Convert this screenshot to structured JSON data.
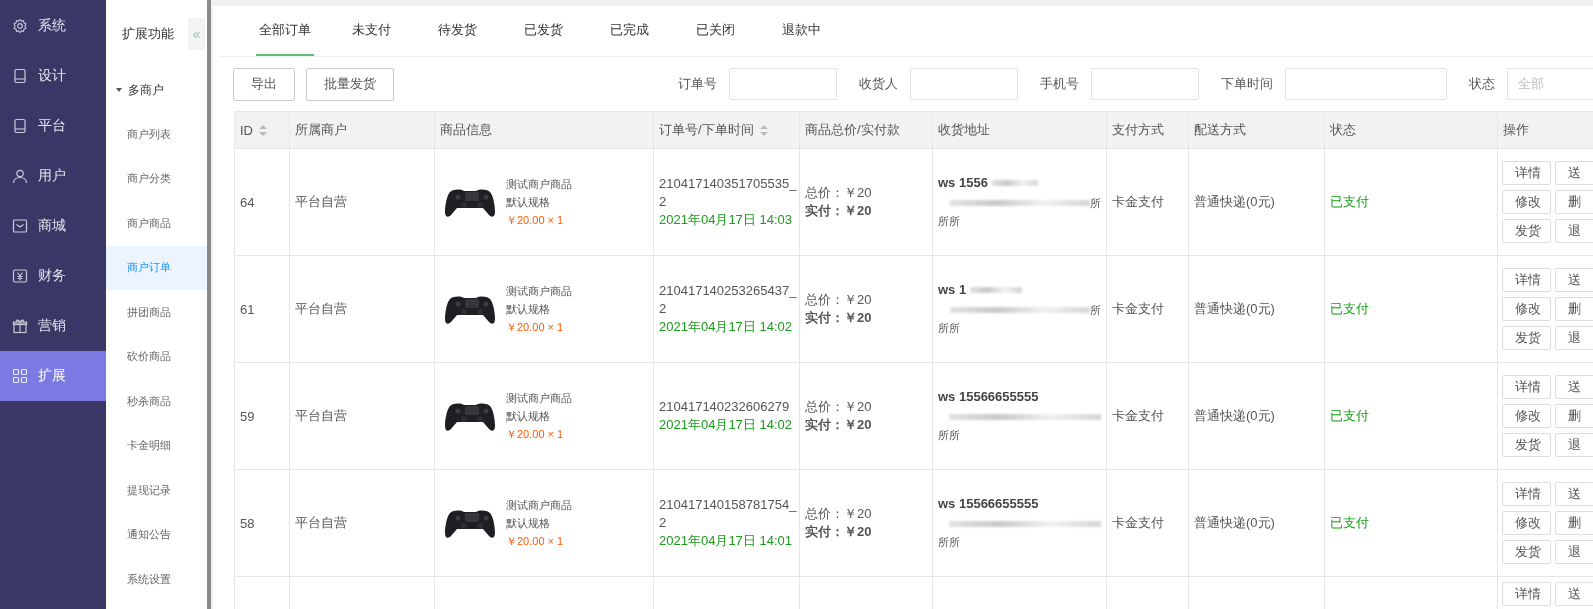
{
  "side_nav": {
    "items": [
      {
        "label": "系统",
        "selected": false
      },
      {
        "label": "设计",
        "selected": false
      },
      {
        "label": "平台",
        "selected": false
      },
      {
        "label": "用户",
        "selected": false
      },
      {
        "label": "商城",
        "selected": false
      },
      {
        "label": "财务",
        "selected": false
      },
      {
        "label": "营销",
        "selected": false
      },
      {
        "label": "扩展",
        "selected": true
      }
    ]
  },
  "sub_nav": {
    "title": "扩展功能",
    "collapse_glyph": "«",
    "group": {
      "label": "多商户",
      "expanded": true,
      "items": [
        {
          "label": "商户列表",
          "selected": false
        },
        {
          "label": "商户分类",
          "selected": false
        },
        {
          "label": "商户商品",
          "selected": false
        },
        {
          "label": "商户订单",
          "selected": true
        },
        {
          "label": "拼团商品",
          "selected": false
        },
        {
          "label": "砍价商品",
          "selected": false
        },
        {
          "label": "秒杀商品",
          "selected": false
        },
        {
          "label": "卡金明细",
          "selected": false
        },
        {
          "label": "提现记录",
          "selected": false
        },
        {
          "label": "通知公告",
          "selected": false
        },
        {
          "label": "系统设置",
          "selected": false
        }
      ]
    }
  },
  "tabs": [
    {
      "label": "全部订单",
      "selected": true
    },
    {
      "label": "未支付",
      "selected": false
    },
    {
      "label": "待发货",
      "selected": false
    },
    {
      "label": "已发货",
      "selected": false
    },
    {
      "label": "已完成",
      "selected": false
    },
    {
      "label": "已关闭",
      "selected": false
    },
    {
      "label": "退款中",
      "selected": false
    }
  ],
  "toolbar": {
    "buttons": [
      "导出",
      "批量发货"
    ],
    "filters": [
      {
        "label": "订单号",
        "kind": "input"
      },
      {
        "label": "收货人",
        "kind": "input"
      },
      {
        "label": "手机号",
        "kind": "input"
      },
      {
        "label": "下单时间",
        "kind": "date"
      },
      {
        "label": "状态",
        "kind": "select",
        "placeholder": "全部"
      }
    ]
  },
  "table": {
    "columns": [
      {
        "label": "ID",
        "sortable": true
      },
      {
        "label": "所属商户",
        "sortable": false
      },
      {
        "label": "商品信息",
        "sortable": false
      },
      {
        "label": "订单号/下单时间",
        "sortable": true
      },
      {
        "label": "商品总价/实付款",
        "sortable": false
      },
      {
        "label": "收货地址",
        "sortable": false
      },
      {
        "label": "支付方式",
        "sortable": false
      },
      {
        "label": "配送方式",
        "sortable": false
      },
      {
        "label": "状态",
        "sortable": false
      },
      {
        "label": "操作",
        "sortable": false
      }
    ],
    "rows": [
      {
        "id": "64",
        "merchant": "平台自营",
        "product": {
          "name": "测试商户商品",
          "spec": "默认规格",
          "price": "￥20.00 × 1"
        },
        "order_no": "210417140351705535_2",
        "order_time": "2021年04月17日 14:03",
        "total": "总价：￥20",
        "paid": "实付：￥20",
        "recipient": "ws 1556",
        "recipient_blurred": true,
        "address_tail": "所",
        "address_line_3": "所所",
        "payment": "卡金支付",
        "delivery": "普通快递(0元)",
        "status": "已支付",
        "actions": [
          "详情",
          "送",
          "修改",
          "删",
          "发货",
          "退"
        ]
      },
      {
        "id": "61",
        "merchant": "平台自营",
        "product": {
          "name": "测试商户商品",
          "spec": "默认规格",
          "price": "￥20.00 × 1"
        },
        "order_no": "210417140253265437_2",
        "order_time": "2021年04月17日 14:02",
        "total": "总价：￥20",
        "paid": "实付：￥20",
        "recipient": "ws 1",
        "recipient_blurred": true,
        "address_tail": "所",
        "address_line_3": "所所",
        "payment": "卡金支付",
        "delivery": "普通快递(0元)",
        "status": "已支付",
        "actions": [
          "详情",
          "送",
          "修改",
          "删",
          "发货",
          "退"
        ]
      },
      {
        "id": "59",
        "merchant": "平台自营",
        "product": {
          "name": "测试商户商品",
          "spec": "默认规格",
          "price": "￥20.00 × 1"
        },
        "order_no": "210417140232606279",
        "order_time": "2021年04月17日 14:02",
        "total": "总价：￥20",
        "paid": "实付：￥20",
        "recipient": "ws 15566655555",
        "recipient_blurred": false,
        "address_line_3": "所所",
        "payment": "卡金支付",
        "delivery": "普通快递(0元)",
        "status": "已支付",
        "actions": [
          "详情",
          "送",
          "修改",
          "删",
          "发货",
          "退"
        ]
      },
      {
        "id": "58",
        "merchant": "平台自营",
        "product": {
          "name": "测试商户商品",
          "spec": "默认规格",
          "price": "￥20.00 × 1"
        },
        "order_no": "210417140158781754_2",
        "order_time": "2021年04月17日 14:01",
        "total": "总价：￥20",
        "paid": "实付：￥20",
        "recipient": "ws 15566655555",
        "recipient_blurred": false,
        "address_line_3": "所所",
        "payment": "卡金支付",
        "delivery": "普通快递(0元)",
        "status": "已支付",
        "actions": [
          "详情",
          "送",
          "修改",
          "删",
          "发货",
          "退"
        ]
      },
      {
        "actions": [
          "详情",
          "送"
        ]
      }
    ]
  }
}
